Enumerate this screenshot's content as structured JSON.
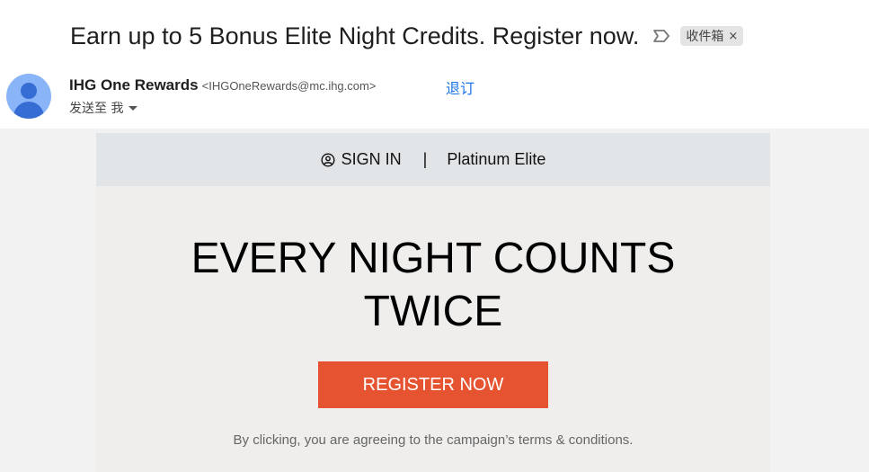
{
  "email": {
    "subject": "Earn up to 5 Bonus Elite Night Credits. Register now.",
    "label": "收件箱",
    "label_remove": "×",
    "sender_name": "IHG One Rewards",
    "sender_email": "<IHGOneRewards@mc.ihg.com>",
    "unsubscribe": "退订",
    "to_line": "发送至 我"
  },
  "body": {
    "sign_in": "SIGN IN",
    "separator": "|",
    "tier": "Platinum Elite",
    "headline_line1": "EVERY NIGHT COUNTS",
    "headline_line2": "TWICE",
    "cta": "REGISTER NOW",
    "disclaimer": "By clicking, you are agreeing to the campaign’s terms & conditions."
  },
  "colors": {
    "cta_bg": "#e55330",
    "link": "#1a73e8",
    "avatar_bg": "#8ab4f8",
    "topbar_bg": "#e1e5e8"
  },
  "icons": [
    "importance-marker-icon",
    "user-avatar-icon",
    "caret-down-icon",
    "user-circle-icon"
  ]
}
